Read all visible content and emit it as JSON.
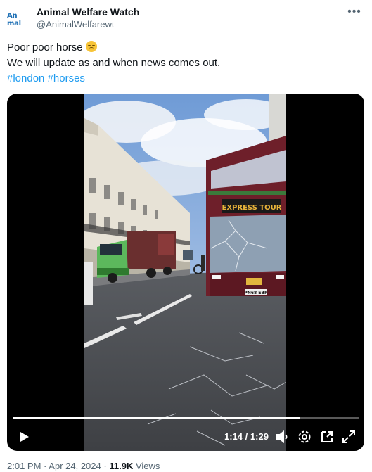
{
  "tweet": {
    "author": {
      "display_name": "Animal Welfare Watch",
      "handle": "@AnimalWelfarewt",
      "avatar_text": "An mal"
    },
    "more_icon": "ellipsis-icon",
    "text_line1": "Poor poor horse",
    "emoji": "disappointed-face-emoji",
    "text_line2": "We will update as and when news comes out.",
    "hashtags": [
      "#london",
      "#horses"
    ],
    "video": {
      "current_time": "1:14",
      "separator": "/",
      "duration": "1:29",
      "progress_fraction": 0.83,
      "controls": [
        "play-icon",
        "volume-icon",
        "settings-icon",
        "picture-in-picture-icon",
        "fullscreen-icon"
      ],
      "bus_sign": "EXPRESS TOUR",
      "bus_plate": "PN68 EBR"
    },
    "footer": {
      "time": "2:01 PM",
      "dot1": "·",
      "date": "Apr 24, 2024",
      "dot2": "·",
      "views_count": "11.9K",
      "views_label": "Views"
    }
  }
}
